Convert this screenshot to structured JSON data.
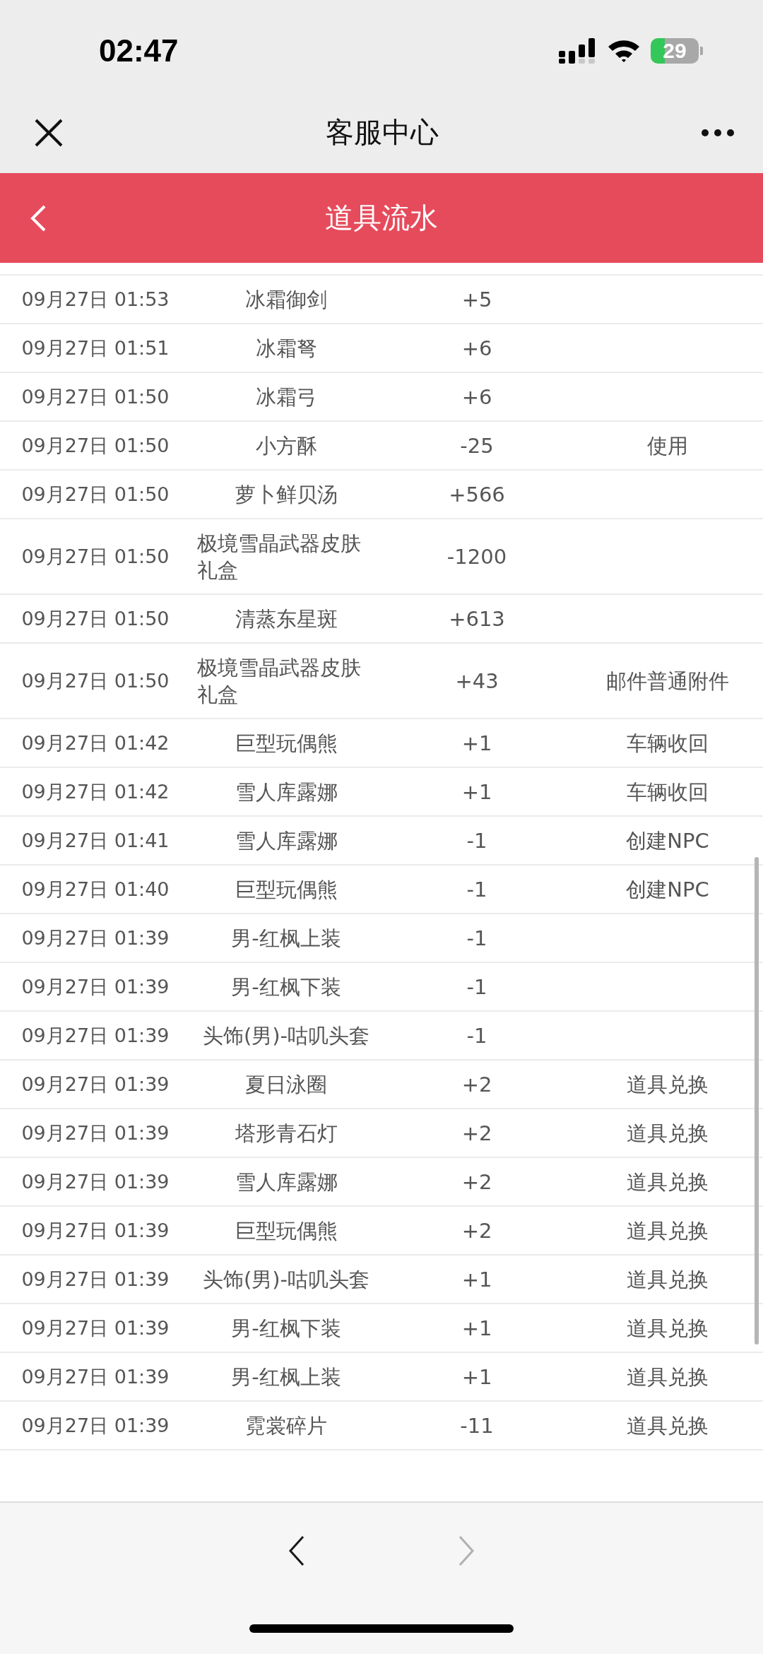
{
  "status_bar": {
    "time": "02:47",
    "battery": "29"
  },
  "title_bar": {
    "title": "客服中心"
  },
  "header": {
    "title": "道具流水"
  },
  "records": [
    {
      "time": "09月27日 01:53",
      "item": "冰霜御剑",
      "amount": "+5"
    },
    {
      "time": "09月27日 01:51",
      "item": "冰霜弩",
      "amount": "+6"
    },
    {
      "time": "09月27日 01:50",
      "item": "冰霜弓",
      "amount": "+6"
    },
    {
      "time": "09月27日 01:50",
      "item": "小方酥",
      "amount": "-25",
      "source": "使用"
    },
    {
      "time": "09月27日 01:50",
      "item": "萝卜鲜贝汤",
      "amount": "+566"
    },
    {
      "time": "09月27日 01:50",
      "item": "极境雪晶武器皮肤礼盒",
      "amount": "-1200"
    },
    {
      "time": "09月27日 01:50",
      "item": "清蒸东星斑",
      "amount": "+613"
    },
    {
      "time": "09月27日 01:50",
      "item": "极境雪晶武器皮肤礼盒",
      "amount": "+43",
      "source": "邮件普通附件"
    },
    {
      "time": "09月27日 01:42",
      "item": "巨型玩偶熊",
      "amount": "+1",
      "source": "车辆收回"
    },
    {
      "time": "09月27日 01:42",
      "item": "雪人库露娜",
      "amount": "+1",
      "source": "车辆收回"
    },
    {
      "time": "09月27日 01:41",
      "item": "雪人库露娜",
      "amount": "-1",
      "source": "创建NPC"
    },
    {
      "time": "09月27日 01:40",
      "item": "巨型玩偶熊",
      "amount": "-1",
      "source": "创建NPC"
    },
    {
      "time": "09月27日 01:39",
      "item": "男-红枫上装",
      "amount": "-1"
    },
    {
      "time": "09月27日 01:39",
      "item": "男-红枫下装",
      "amount": "-1"
    },
    {
      "time": "09月27日 01:39",
      "item": "头饰(男)-咕叽头套",
      "amount": "-1"
    },
    {
      "time": "09月27日 01:39",
      "item": "夏日泳圈",
      "amount": "+2",
      "source": "道具兑换"
    },
    {
      "time": "09月27日 01:39",
      "item": "塔形青石灯",
      "amount": "+2",
      "source": "道具兑换"
    },
    {
      "time": "09月27日 01:39",
      "item": "雪人库露娜",
      "amount": "+2",
      "source": "道具兑换"
    },
    {
      "time": "09月27日 01:39",
      "item": "巨型玩偶熊",
      "amount": "+2",
      "source": "道具兑换"
    },
    {
      "time": "09月27日 01:39",
      "item": "头饰(男)-咕叽头套",
      "amount": "+1",
      "source": "道具兑换"
    },
    {
      "time": "09月27日 01:39",
      "item": "男-红枫下装",
      "amount": "+1",
      "source": "道具兑换"
    },
    {
      "time": "09月27日 01:39",
      "item": "男-红枫上装",
      "amount": "+1",
      "source": "道具兑换"
    },
    {
      "time": "09月27日 01:39",
      "item": "霓裳碎片",
      "amount": "-11",
      "source": "道具兑换"
    }
  ],
  "pager": {
    "back": {
      "disabled": false
    },
    "forward": {
      "disabled": true
    }
  }
}
